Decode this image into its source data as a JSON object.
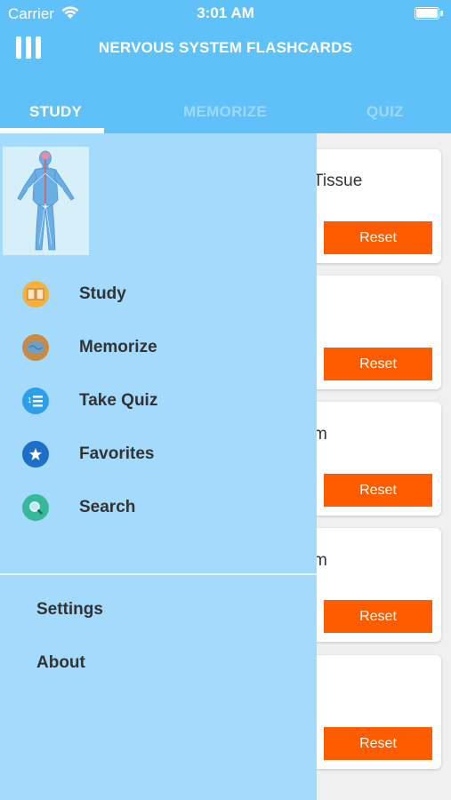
{
  "status_bar": {
    "carrier": "Carrier",
    "time": "3:01 AM"
  },
  "header": {
    "title": "NERVOUS SYSTEM FLASHCARDS",
    "menu_icon": "menu-icon"
  },
  "tabs": [
    {
      "label": "STUDY",
      "active": true
    },
    {
      "label": "MEMORIZE",
      "active": false
    },
    {
      "label": "QUIZ",
      "active": false
    }
  ],
  "cards": [
    {
      "text": "Tissue",
      "reset_label": "Reset"
    },
    {
      "text": "",
      "reset_label": "Reset"
    },
    {
      "text": "m",
      "reset_label": "Reset"
    },
    {
      "text": "m",
      "reset_label": "Reset"
    },
    {
      "text": "",
      "reset_label": "Reset"
    }
  ],
  "drawer": {
    "items": [
      {
        "label": "Study",
        "icon": "book-icon"
      },
      {
        "label": "Memorize",
        "icon": "brain-icon"
      },
      {
        "label": "Take Quiz",
        "icon": "list-icon"
      },
      {
        "label": "Favorites",
        "icon": "star-icon"
      },
      {
        "label": "Search",
        "icon": "search-icon"
      }
    ],
    "secondary": [
      {
        "label": "Settings"
      },
      {
        "label": "About"
      }
    ]
  },
  "colors": {
    "header": "#60c1f8",
    "drawer": "#a4dafc",
    "reset_button": "#ff5c00",
    "tab_active": "#ffffff",
    "tab_inactive": "#9ed8fb"
  }
}
